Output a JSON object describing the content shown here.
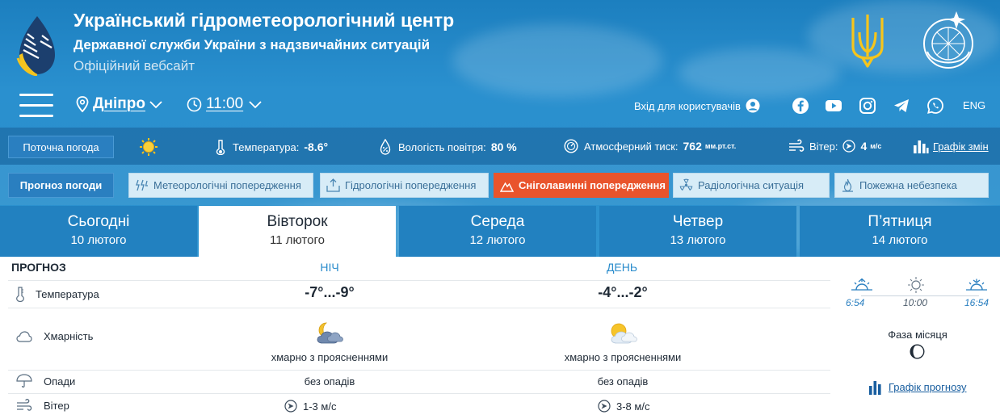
{
  "site": {
    "title": "Український гідрометеорологічний центр",
    "subtitle": "Державної служби України з надзвичайних ситуацій",
    "official": "Офіційний вебсайт"
  },
  "nav": {
    "city": "Дніпро",
    "time": "11:00",
    "login": "Вхід для користувачів",
    "lang": "ENG",
    "social_icons": [
      "facebook-icon",
      "youtube-icon",
      "instagram-icon",
      "telegram-icon",
      "whatsapp-icon"
    ]
  },
  "current": {
    "button": "Поточна погода",
    "temperature_label": "Температура:",
    "temperature_value": "-8.6°",
    "humidity_label": "Вологість повітря:",
    "humidity_value": "80 %",
    "pressure_label": "Атмосферний тиск:",
    "pressure_value": "762",
    "pressure_unit": "мм.рт.ст.",
    "wind_label": "Вітер:",
    "wind_value": "4",
    "wind_unit": "м/с",
    "changes_link": "Графік змін"
  },
  "forecast_bar": {
    "button": "Прогноз погоди",
    "warnings": [
      {
        "label": "Метеорологічні попередження",
        "active": false
      },
      {
        "label": "Гідрологічні попередження",
        "active": false
      },
      {
        "label": "Сніголавинні попередження",
        "active": true
      },
      {
        "label": "Радіологічна ситуація",
        "active": false
      },
      {
        "label": "Пожежна небезпека",
        "active": false
      }
    ]
  },
  "days": [
    {
      "name": "Сьогодні",
      "date": "10 лютого",
      "active": false
    },
    {
      "name": "Вівторок",
      "date": "11 лютого",
      "active": true
    },
    {
      "name": "Середа",
      "date": "12 лютого",
      "active": false
    },
    {
      "name": "Четвер",
      "date": "13 лютого",
      "active": false
    },
    {
      "name": "П’ятниця",
      "date": "14 лютого",
      "active": false
    }
  ],
  "table": {
    "heading": "ПРОГНОЗ",
    "night_label": "НІЧ",
    "day_label": "ДЕНЬ",
    "rows": {
      "temperature": {
        "label": "Температура",
        "night": "-7°...-9°",
        "day": "-4°...-2°"
      },
      "cloudiness": {
        "label": "Хмарність",
        "night": "хмарно з проясненнями",
        "day": "хмарно з проясненнями"
      },
      "precipitation": {
        "label": "Опади",
        "night": "без опадів",
        "day": "без опадів"
      },
      "wind": {
        "label": "Вітер",
        "night": "1-3 м/с",
        "day": "3-8 м/с"
      }
    }
  },
  "sun": {
    "sunrise": "6:54",
    "noon": "10:00",
    "sunset": "16:54"
  },
  "moon": {
    "title": "Фаза місяця"
  },
  "graph_link": "Графік прогнозу",
  "colors": {
    "header_blue": "#2a90cf",
    "tab_blue": "#2281c0",
    "warning_active": "#e9542c",
    "warning_bg": "#d7ecf7",
    "link_blue": "#1a5fa0"
  }
}
